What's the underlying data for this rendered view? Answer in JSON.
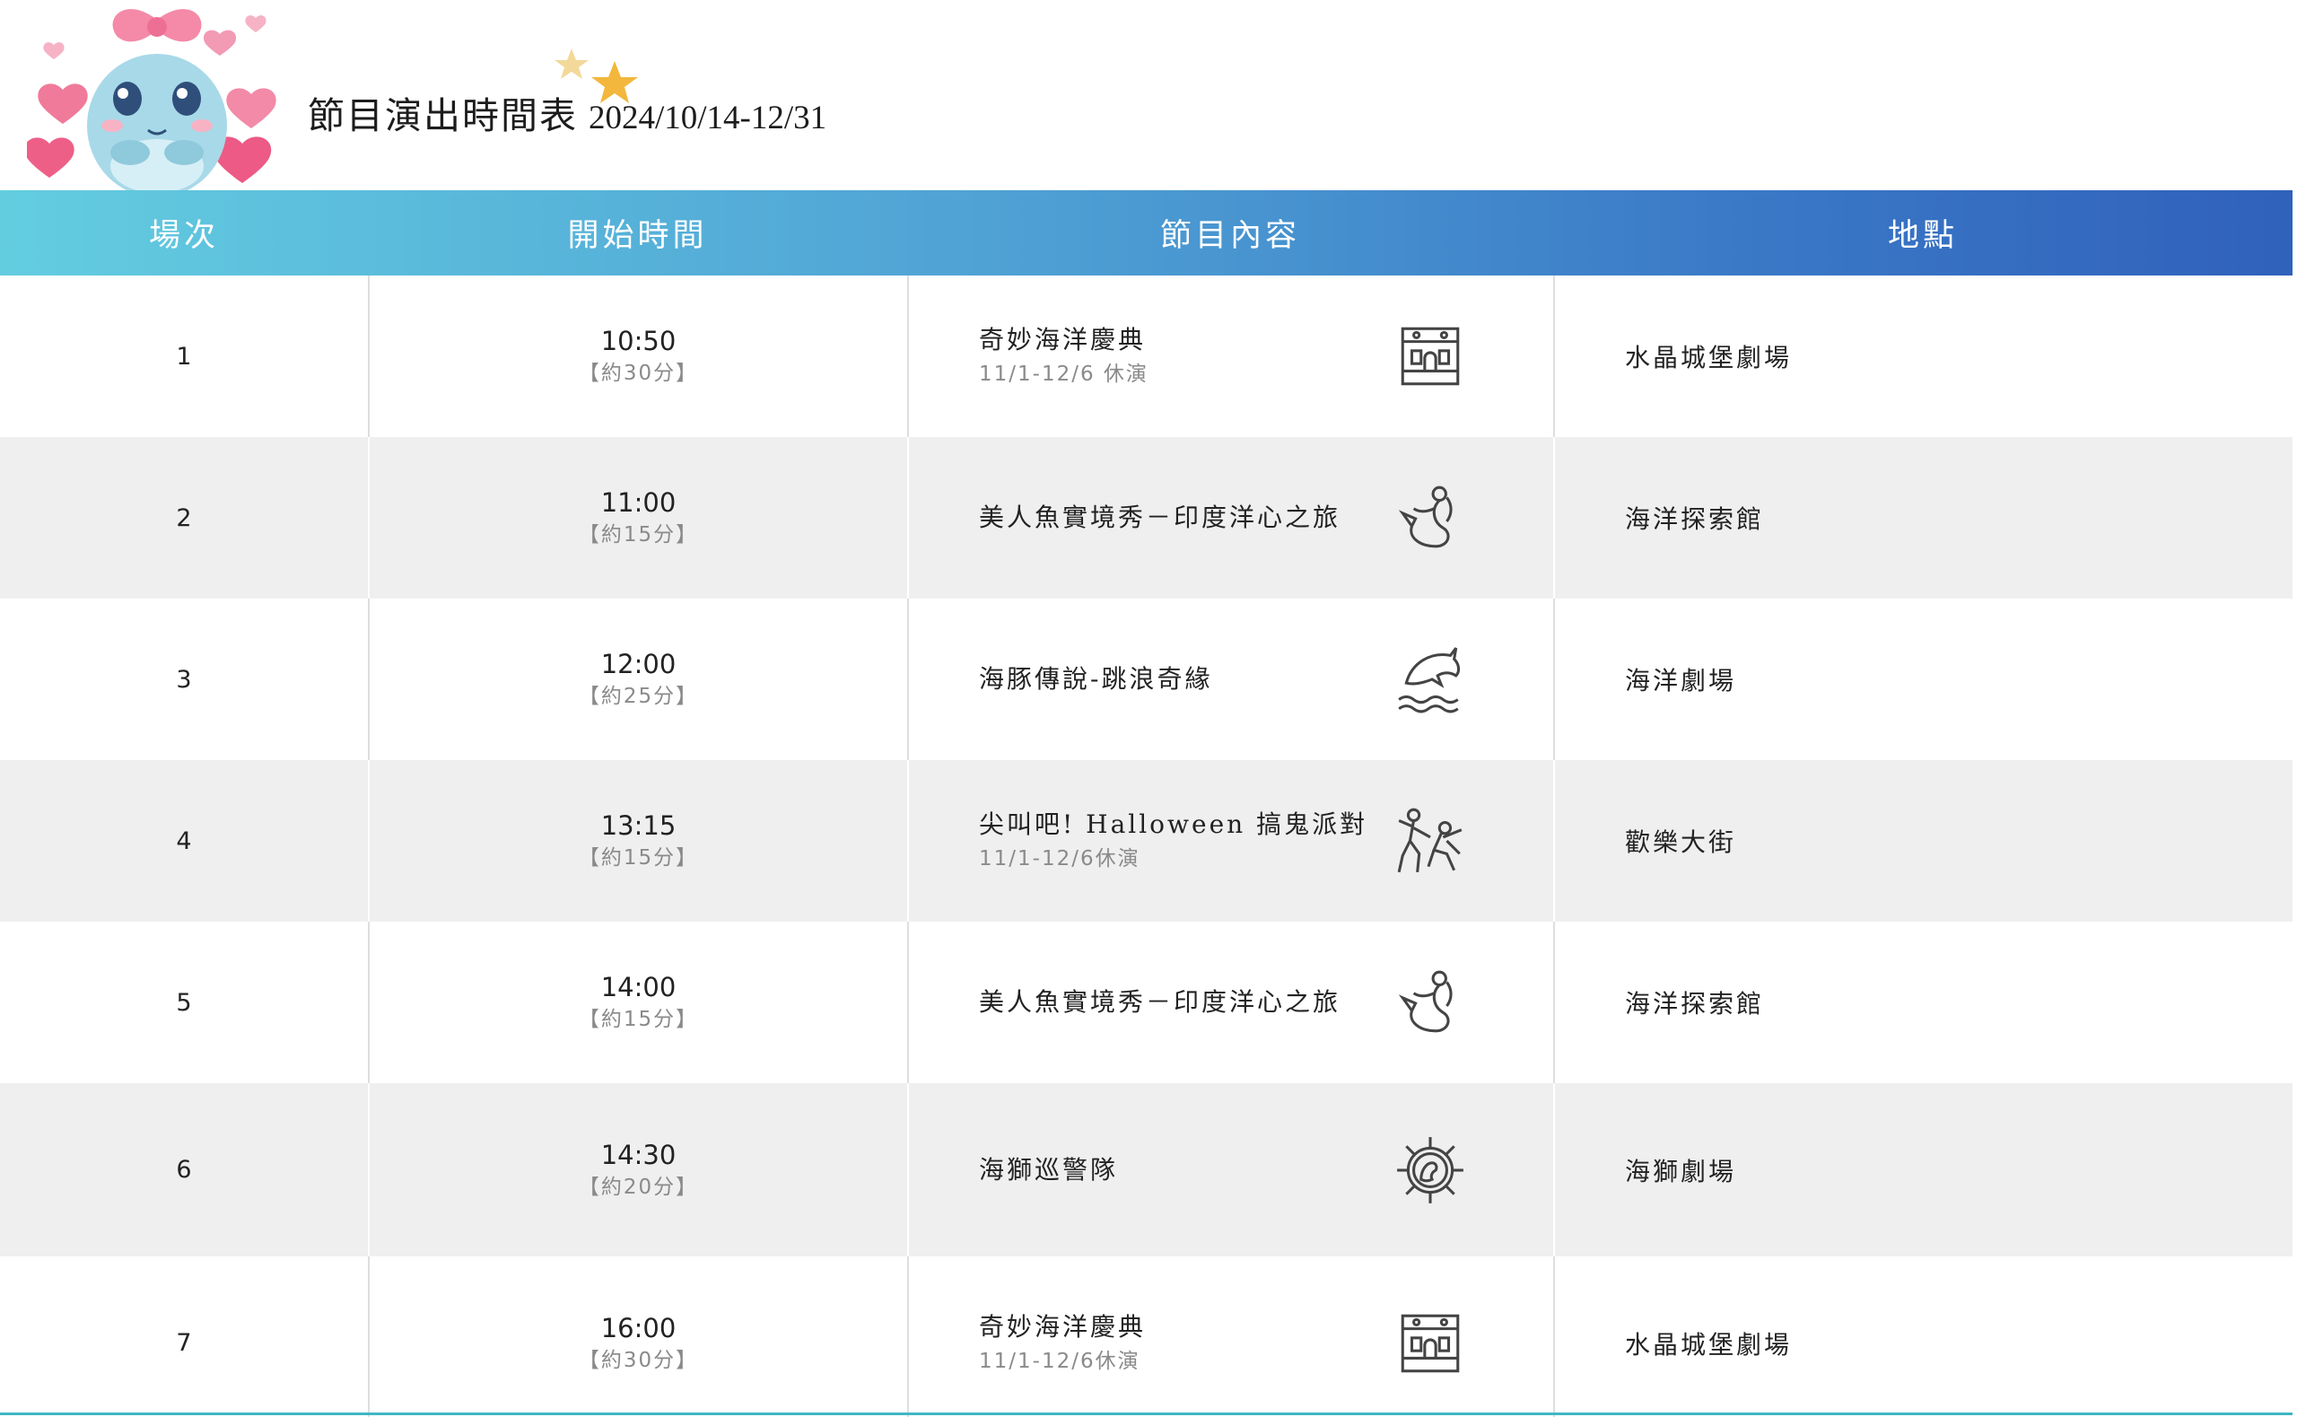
{
  "header": {
    "title": "節目演出時間表",
    "date_range": "2024/10/14-12/31",
    "mascot_icon": "dolphin-mascot-with-hearts",
    "star_icon": "star-icon"
  },
  "colors": {
    "header_gradient_start": "#63cde0",
    "header_gradient_end": "#3061bb",
    "row_alt": "#efefef",
    "muted_text": "#8a8a8a"
  },
  "table": {
    "columns": [
      "場次",
      "開始時間",
      "節目內容",
      "地點"
    ],
    "rows": [
      {
        "no": "1",
        "time": "10:50",
        "duration": "【約30分】",
        "show": "奇妙海洋慶典",
        "note": "11/1-12/6 休演",
        "icon": "castle-icon",
        "location": "水晶城堡劇場"
      },
      {
        "no": "2",
        "time": "11:00",
        "duration": "【約15分】",
        "show": "美人魚實境秀－印度洋心之旅",
        "note": "",
        "icon": "mermaid-icon",
        "location": "海洋探索館"
      },
      {
        "no": "3",
        "time": "12:00",
        "duration": "【約25分】",
        "show": "海豚傳說-跳浪奇緣",
        "note": "",
        "icon": "dolphin-icon",
        "location": "海洋劇場"
      },
      {
        "no": "4",
        "time": "13:15",
        "duration": "【約15分】",
        "show": "尖叫吧! Halloween 搞鬼派對",
        "note": "11/1-12/6休演",
        "icon": "dancers-icon",
        "location": "歡樂大街"
      },
      {
        "no": "5",
        "time": "14:00",
        "duration": "【約15分】",
        "show": "美人魚實境秀－印度洋心之旅",
        "note": "",
        "icon": "mermaid-icon",
        "location": "海洋探索館"
      },
      {
        "no": "6",
        "time": "14:30",
        "duration": "【約20分】",
        "show": "海獅巡警隊",
        "note": "",
        "icon": "ship-wheel-sealion-icon",
        "location": "海獅劇場"
      },
      {
        "no": "7",
        "time": "16:00",
        "duration": "【約30分】",
        "show": "奇妙海洋慶典",
        "note": "11/1-12/6休演",
        "icon": "castle-icon",
        "location": "水晶城堡劇場"
      }
    ]
  }
}
